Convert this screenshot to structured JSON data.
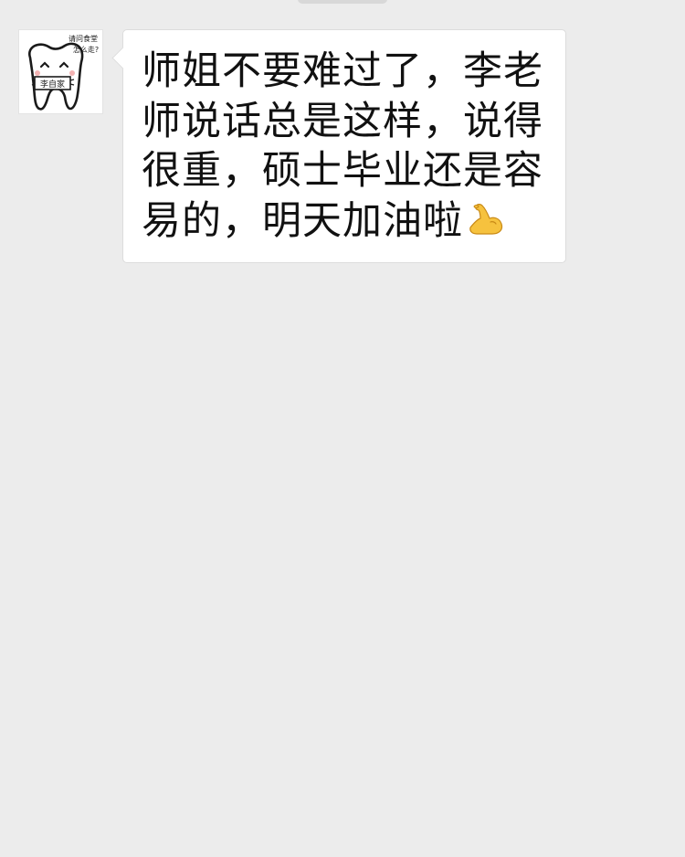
{
  "chat": {
    "message_text": "师姐不要难过了，李老师说话总是这样，说得很重，硕士毕业还是容易的，明天加油啦",
    "message_emoji": "flexed-biceps-icon"
  },
  "avatar": {
    "alt": "avatar",
    "caption_line1": "请问食堂",
    "caption_line2": "怎么走?",
    "sign_text": "李自家"
  }
}
